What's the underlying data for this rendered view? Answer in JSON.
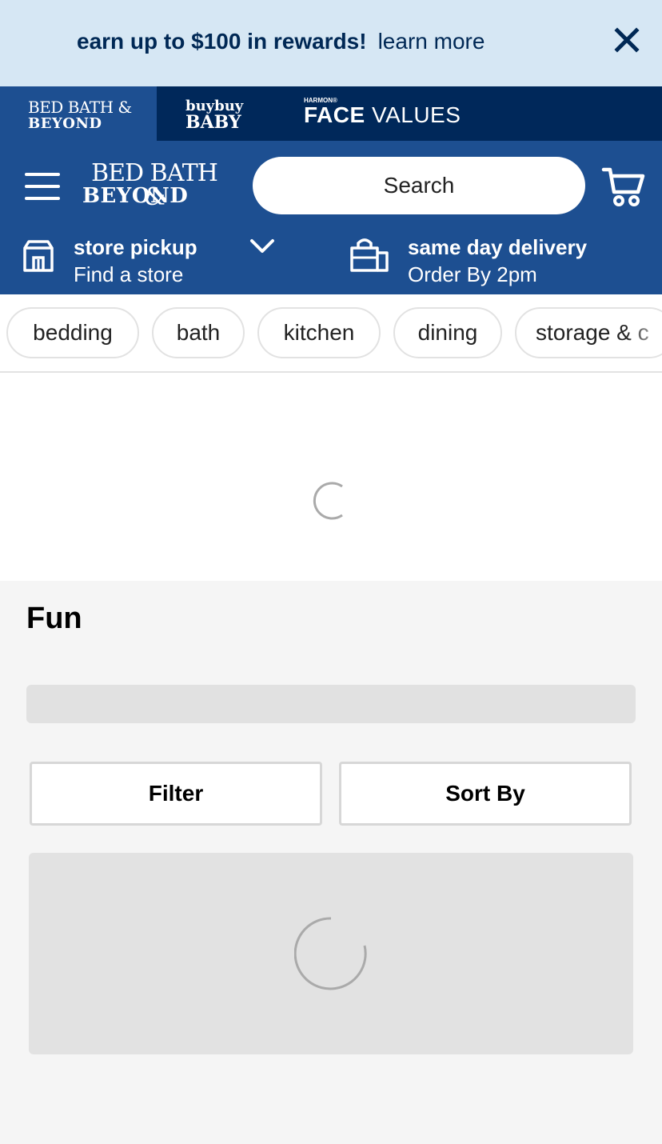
{
  "promo": {
    "text": "earn up to $100 in rewards!",
    "link": "learn more",
    "close_icon": "close-icon"
  },
  "brands": {
    "bbb": {
      "line1": "BED BATH &",
      "line2": "BEYOND"
    },
    "buybuy": {
      "line1": "buybuy",
      "line2": "BABY"
    },
    "harmon": {
      "small": "HARMON®",
      "face": "FACE",
      "values": "VALUES"
    }
  },
  "header": {
    "logo_line1": "BED BATH &",
    "logo_line2": "BEYOND",
    "search_placeholder": "Search",
    "menu_icon": "hamburger-menu-icon",
    "cart_icon": "shopping-cart-icon"
  },
  "pickup": {
    "title": "store pickup",
    "subtitle": "Find a store",
    "icon": "store-icon",
    "chevron_icon": "chevron-down-icon"
  },
  "delivery": {
    "title": "same day delivery",
    "subtitle": "Order By 2pm",
    "icon": "delivery-bag-icon"
  },
  "categories": [
    "bedding",
    "bath",
    "kitchen",
    "dining",
    "storage & c"
  ],
  "page": {
    "title": "Fun",
    "filter_label": "Filter",
    "sort_label": "Sort By"
  },
  "colors": {
    "promo_bg": "#d6e7f4",
    "brand_bar": "#00285a",
    "header_blue": "#1d4f91",
    "skeleton": "#e1e1e1"
  }
}
